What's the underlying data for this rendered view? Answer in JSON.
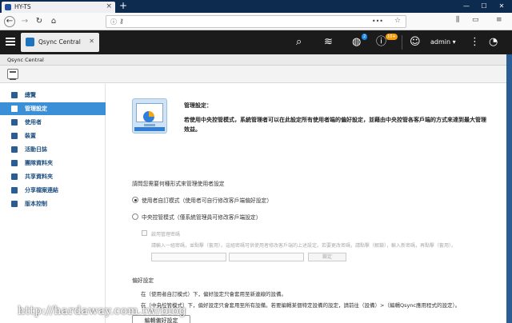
{
  "browser": {
    "tab_title": "HY-TS",
    "tab_close": "×",
    "new_tab": "+",
    "win_min": "—",
    "win_max": "☐",
    "win_close": "✕",
    "url_more": "•••",
    "icons": [
      "back-icon",
      "forward-icon",
      "reload-icon",
      "home-icon",
      "info-icon",
      "key-icon",
      "bookmark-star-icon",
      "library-icon",
      "reader-icon",
      "menu-icon"
    ]
  },
  "qts": {
    "tab_title": "Qsync Central",
    "tab_close": "✕",
    "badge_tasks": "2",
    "badge_notice": "10+",
    "username": "admin ▾",
    "icons": [
      "hamburger-icon",
      "search-icon",
      "stack-icon",
      "tasks-icon",
      "info-icon",
      "user-icon",
      "more-icon",
      "dashboard-icon"
    ]
  },
  "app": {
    "title": "Qsync Central",
    "sidebar": [
      {
        "label": "總覽",
        "active": false
      },
      {
        "label": "管理設定",
        "active": true
      },
      {
        "label": "使用者",
        "active": false
      },
      {
        "label": "裝置",
        "active": false
      },
      {
        "label": "活動日誌",
        "active": false
      },
      {
        "label": "團隊資料夾",
        "active": false
      },
      {
        "label": "共享資料夾",
        "active": false
      },
      {
        "label": "分享檔案連結",
        "active": false
      },
      {
        "label": "版本控制",
        "active": false
      }
    ],
    "main": {
      "title": "管理設定：",
      "description": "若使用中央控管模式，系統管理者可以在此設定所有使用者端的偏好設定，並藉由中央控管各客戶端的方式來達到最大管理效益。",
      "question": "請問您需要何種形式來管理使用者設定",
      "option_user": "使用者自訂模式（使用者可自行修改客戶端偏好設定）",
      "option_central": "中央控管模式（僅系統管理員可修改客戶端設定）",
      "enable_password": "啟用管理密碼",
      "password_hint": "請輸入一組密碼，並點擊（套用）。這組密碼可供使用者修改客戶端的上述設定。若要更改密碼，請點擊（解鎖），輸入新密碼，再點擊（套用）。",
      "lock_button": "鎖定",
      "pref_title": "偏好設定",
      "pref_line1": "在（使用者自訂模式）下，偏好設定只會套用至新連線的設備。",
      "pref_line2": "在（中央控管模式）下，偏好設定只會套用至所有設備。若要編輯某個特定設備的設定，請前往（設備）>（編輯Qsync應用程式的設定）。",
      "edit_button": "編輯偏好設定"
    }
  },
  "watermark": "http://hardaway.com.tw/blog"
}
